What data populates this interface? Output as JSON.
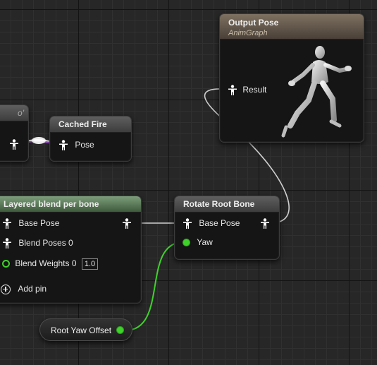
{
  "nodes": {
    "partial": {
      "label": "o'"
    },
    "cached_fire": {
      "title": "Cached Fire",
      "pin_pose": "Pose"
    },
    "output_pose": {
      "title": "Output Pose",
      "subtitle": "AnimGraph",
      "pin_result": "Result"
    },
    "layered_blend": {
      "title": "Layered blend per bone",
      "pin_base_pose": "Base Pose",
      "pin_blend_poses": "Blend Poses 0",
      "pin_blend_weights": "Blend Weights 0",
      "blend_weight_value": "1.0",
      "add_pin": "Add pin"
    },
    "rotate_root_bone": {
      "title": "Rotate Root Bone",
      "pin_base_pose": "Base Pose",
      "pin_yaw": "Yaw"
    },
    "root_yaw_offset": {
      "label": "Root Yaw Offset"
    }
  },
  "colors": {
    "grid_bg": "#272727",
    "pose_wire": "#cfcfcf",
    "float_wire": "#3fd22a",
    "exec_highlight": "#ffffff",
    "output_header": "#7e7161",
    "blend_header": "#5f8a5b"
  },
  "icons": {
    "pose_pin": "pose-person-icon",
    "float_pin": "green-dot-icon",
    "add": "plus-circle-icon"
  }
}
